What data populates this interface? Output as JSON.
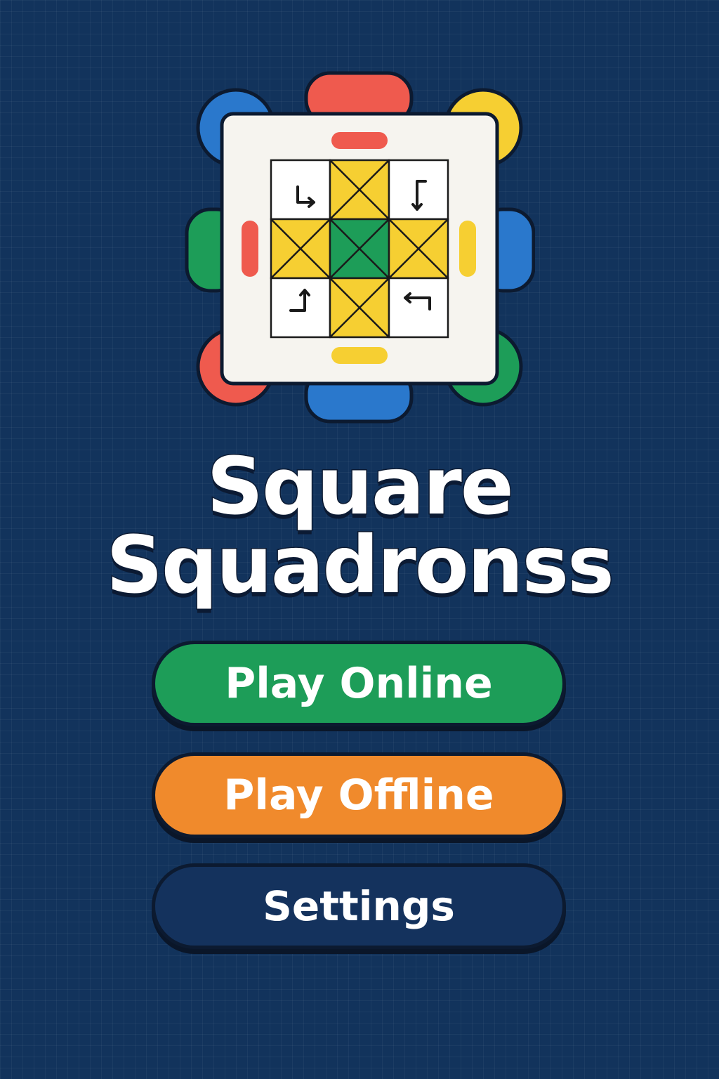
{
  "title": {
    "line1": "Square",
    "line2": "Squadronss"
  },
  "menu": {
    "play_online": "Play Online",
    "play_offline": "Play Offline",
    "settings": "Settings"
  },
  "logo": {
    "colors": {
      "red": "#ef5a4e",
      "blue": "#2a78cc",
      "yellow": "#f6cf32",
      "green": "#1d9d58",
      "board": "#f6f4ef",
      "outline": "#0c1a30"
    },
    "icons": [
      "corner-arrow-top-left-icon",
      "corner-arrow-top-right-icon",
      "corner-arrow-bottom-left-icon",
      "corner-arrow-bottom-right-icon"
    ]
  },
  "theme": {
    "background": "#12335c",
    "online_color": "#1d9d58",
    "offline_color": "#f08a2c",
    "settings_color": "#14325d"
  }
}
